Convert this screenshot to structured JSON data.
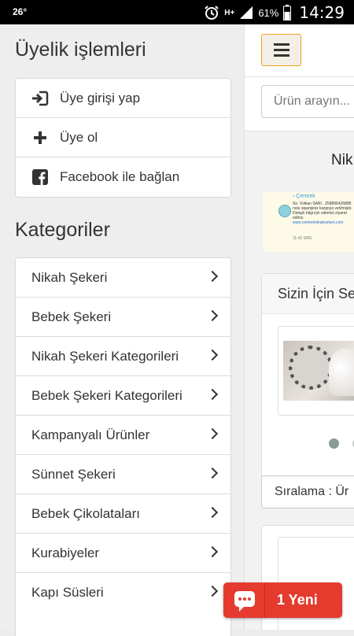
{
  "status_bar": {
    "temperature": "26°",
    "network": "H+",
    "battery": "61%",
    "time": "14:29"
  },
  "sidebar": {
    "account_title": "Üyelik işlemleri",
    "account_items": [
      {
        "label": "Üye girişi yap",
        "icon": "sign-in-icon"
      },
      {
        "label": "Üye ol",
        "icon": "plus-icon"
      },
      {
        "label": "Facebook ile bağlan",
        "icon": "facebook-icon"
      }
    ],
    "categories_title": "Kategoriler",
    "categories": [
      {
        "label": "Nikah Şekeri"
      },
      {
        "label": "Bebek Şekeri"
      },
      {
        "label": "Nikah Şekeri Kategorileri"
      },
      {
        "label": "Bebek Şekeri Kategorileri"
      },
      {
        "label": "Kampanyalı Ürünler"
      },
      {
        "label": "Sünnet Şekeri"
      },
      {
        "label": "Bebek Çikolataları"
      },
      {
        "label": "Kurabiyeler"
      },
      {
        "label": "Kapı Süsleri"
      }
    ]
  },
  "main": {
    "search_placeholder": "Ürün arayın...",
    "heading": "Nik",
    "sms": {
      "brand": "› Çemrek",
      "text": "Sn. Volkan SARI , 258896426885 nolu siparişiniz kargoya verilmiştir. Detaylı bilgi için sitemizi ziyaret ediniz.",
      "link": "www.cemreknikahsekeri.com",
      "time": "11:42 SMS"
    },
    "featured_title": "Sizin İçin Se",
    "sort_label": "Sıralama : Ür",
    "carousel_active_color": "#8a9a95"
  },
  "chat": {
    "label": "1 Yeni",
    "color": "#e53b2e"
  }
}
